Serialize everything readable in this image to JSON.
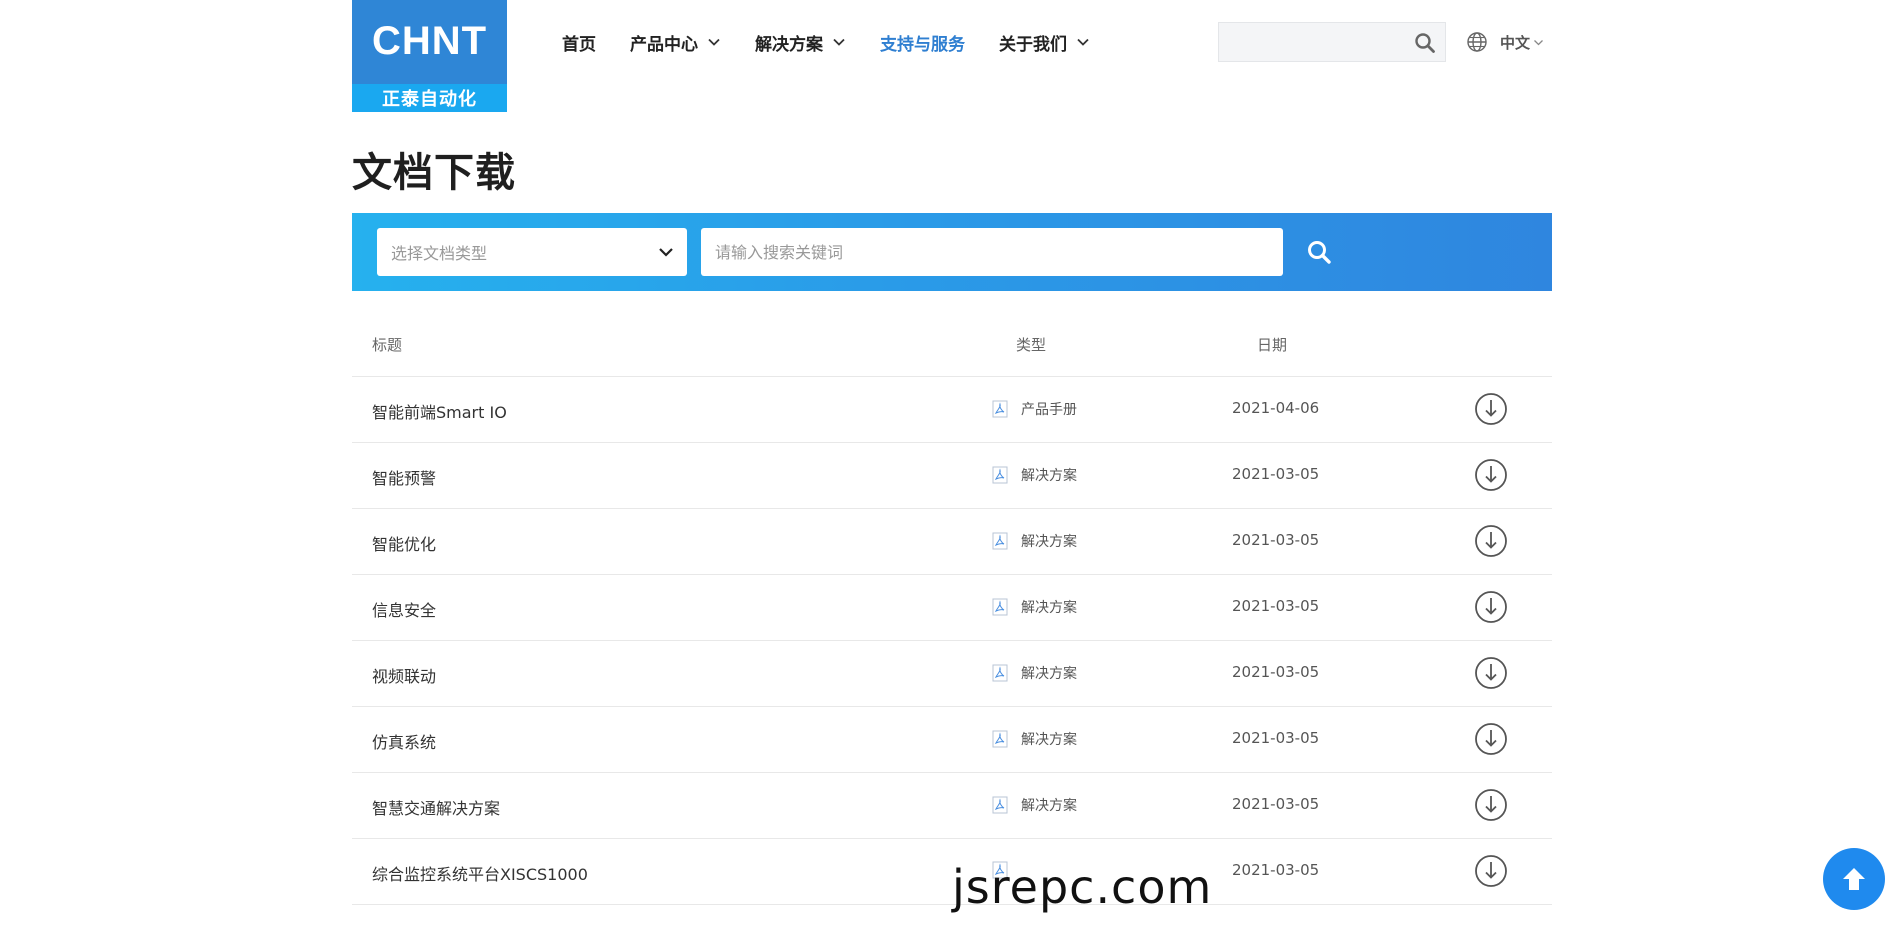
{
  "header": {
    "logo_text": "CHNT",
    "logo_subtext": "正泰自动化",
    "nav": [
      {
        "label": "首页",
        "has_dropdown": false,
        "active": false
      },
      {
        "label": "产品中心",
        "has_dropdown": true,
        "active": false
      },
      {
        "label": "解决方案",
        "has_dropdown": true,
        "active": false
      },
      {
        "label": "支持与服务",
        "has_dropdown": false,
        "active": true
      },
      {
        "label": "关于我们",
        "has_dropdown": true,
        "active": false
      }
    ],
    "search_value": "",
    "language": "中文"
  },
  "page_title": "文档下载",
  "filters": {
    "type_select_placeholder": "选择文档类型",
    "keyword_placeholder": "请输入搜索关键词"
  },
  "table": {
    "columns": {
      "title": "标题",
      "type": "类型",
      "date": "日期"
    },
    "rows": [
      {
        "title": "智能前端Smart IO",
        "type": "产品手册",
        "date": "2021-04-06"
      },
      {
        "title": "智能预警",
        "type": "解决方案",
        "date": "2021-03-05"
      },
      {
        "title": "智能优化",
        "type": "解决方案",
        "date": "2021-03-05"
      },
      {
        "title": "信息安全",
        "type": "解决方案",
        "date": "2021-03-05"
      },
      {
        "title": "视频联动",
        "type": "解决方案",
        "date": "2021-03-05"
      },
      {
        "title": "仿真系统",
        "type": "解决方案",
        "date": "2021-03-05"
      },
      {
        "title": "智慧交通解决方案",
        "type": "解决方案",
        "date": "2021-03-05"
      },
      {
        "title": "综合监控系统平台XISCS1000",
        "type": "",
        "date": "2021-03-05"
      }
    ]
  },
  "watermark": "jsrepc.com",
  "colors": {
    "brand_blue": "#2f86d6",
    "active_nav": "#2f7fd1",
    "banner_start": "#26b1ee",
    "banner_end": "#2f86df",
    "back_to_top": "#1f8aee"
  },
  "icons": {
    "search": "search-icon",
    "globe": "globe-icon",
    "chevron": "chevron-down-icon",
    "pdf": "pdf-icon",
    "download": "download-icon",
    "back_to_top": "arrow-up-icon"
  }
}
